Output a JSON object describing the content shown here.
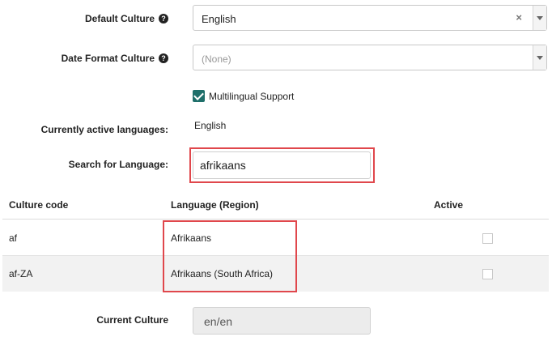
{
  "default_culture": {
    "label": "Default Culture",
    "value": "English",
    "clear": "×"
  },
  "date_format_culture": {
    "label": "Date Format Culture",
    "placeholder": "(None)"
  },
  "multilingual": {
    "label": "Multilingual Support",
    "checked": true
  },
  "active_languages": {
    "label": "Currently active languages:",
    "value": "English"
  },
  "search": {
    "label": "Search for Language:",
    "value": "afrikaans"
  },
  "table": {
    "headers": {
      "culture_code": "Culture code",
      "language": "Language (Region)",
      "active": "Active"
    },
    "rows": [
      {
        "code": "af",
        "language": "Afrikaans",
        "active": false
      },
      {
        "code": "af-ZA",
        "language": "Afrikaans (South Africa)",
        "active": false
      }
    ]
  },
  "current_culture": {
    "label": "Current Culture",
    "value": "en/en"
  },
  "help_glyph": "?",
  "colors": {
    "highlight": "#e0474c",
    "checkbox": "#1f6f6a",
    "row_alt": "#f2f2f2"
  }
}
